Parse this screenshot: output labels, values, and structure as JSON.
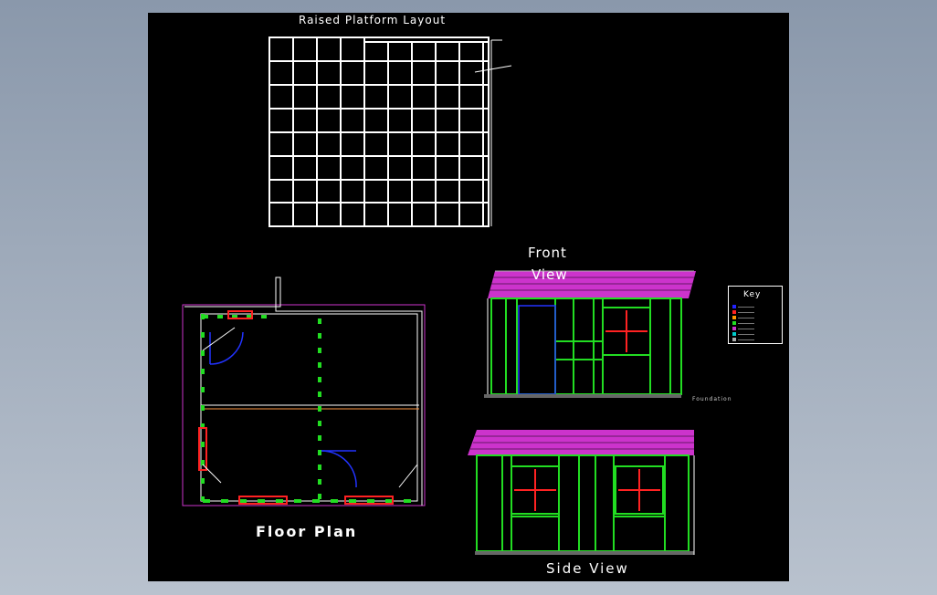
{
  "titles": {
    "platform": "Raised Platform Layout",
    "front_line1": "Front",
    "front_line2": "View",
    "floor_plan": "Floor Plan",
    "side_view": "Side View",
    "key": "Key",
    "foundation": "Foundation"
  },
  "colors": {
    "sheet": "#000000",
    "framing": "#22dd22",
    "window": "#dd2222",
    "roof": "#cc33cc",
    "door": "#2233cc",
    "dimension": "#e0e0a0",
    "key_items": [
      "#2222ff",
      "#ff2222",
      "#ff9900",
      "#22dd22",
      "#cc33cc",
      "#ff00ff",
      "#00cccc",
      "#aaaaaa"
    ]
  }
}
